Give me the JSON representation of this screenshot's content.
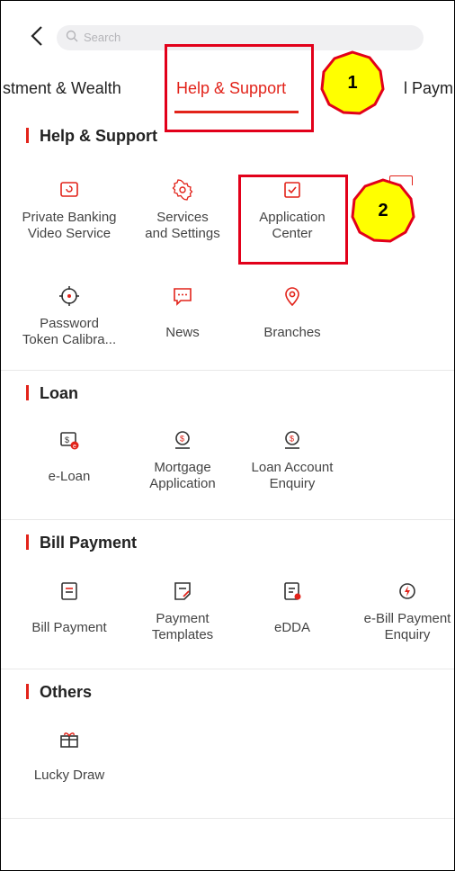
{
  "search": {
    "placeholder": "Search"
  },
  "tabs": [
    {
      "label": "stment & Wealth"
    },
    {
      "label": "Help & Support"
    },
    {
      "label": "l Paym"
    }
  ],
  "sections": {
    "help": {
      "title": "Help & Support",
      "items": [
        {
          "label": "Private Banking\nVideo Service",
          "icon": "video-icon"
        },
        {
          "label": "Services\nand Settings",
          "icon": "gear-icon"
        },
        {
          "label": "Application\nCenter",
          "icon": "checklist-icon"
        },
        {
          "label": "Password\nToken Calibra...",
          "icon": "crosshair-icon"
        },
        {
          "label": "News",
          "icon": "chat-icon"
        },
        {
          "label": "Branches",
          "icon": "location-pin-icon"
        }
      ]
    },
    "loan": {
      "title": "Loan",
      "items": [
        {
          "label": "e-Loan",
          "icon": "e-loan-icon"
        },
        {
          "label": "Mortgage\nApplication",
          "icon": "mortgage-icon"
        },
        {
          "label": "Loan Account\nEnquiry",
          "icon": "loan-enquiry-icon"
        }
      ]
    },
    "bill": {
      "title": "Bill Payment",
      "items": [
        {
          "label": "Bill Payment",
          "icon": "bill-icon"
        },
        {
          "label": "Payment\nTemplates",
          "icon": "template-icon"
        },
        {
          "label": "eDDA",
          "icon": "edda-icon"
        },
        {
          "label": "e-Bill Payment\nEnquiry",
          "icon": "ebill-icon"
        }
      ]
    },
    "others": {
      "title": "Others",
      "items": [
        {
          "label": "Lucky Draw",
          "icon": "gift-icon"
        }
      ]
    }
  },
  "annotations": [
    {
      "label": "1"
    },
    {
      "label": "2"
    }
  ],
  "colors": {
    "accent": "#e2231a",
    "annotation_fill": "#ffff00",
    "annotation_border": "#e2001a"
  }
}
